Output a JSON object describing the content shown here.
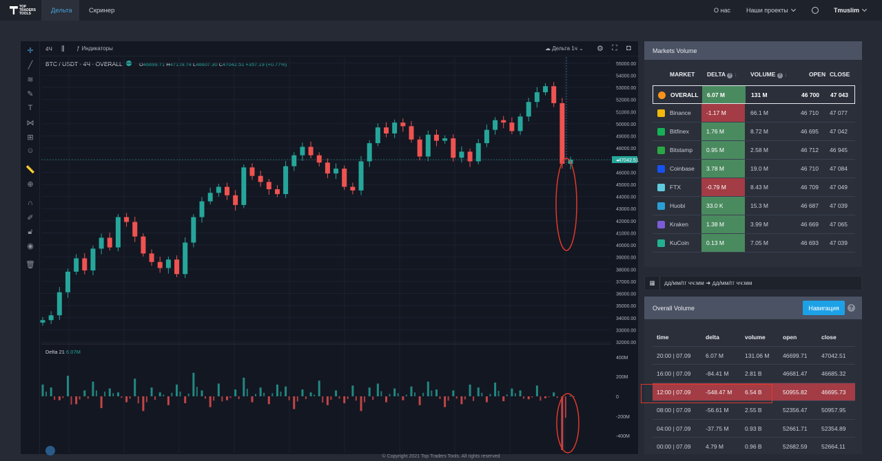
{
  "topnav": {
    "logo_text_1": "TOP",
    "logo_text_2": "TRADERS",
    "logo_text_3": "TOOLS",
    "tab_delta": "Дельта",
    "tab_screener": "Скринер",
    "about": "О нас",
    "projects": "Наши проекты",
    "user": "Tmuslim",
    "theme_icon": "sun-icon"
  },
  "chart_toolbar": {
    "timeframe": "4Ч",
    "indicators": "Индикаторы",
    "delta_dropdown": "Дельта 1ч"
  },
  "legend": {
    "symbol": "BTC / USDT · 4Ч · OVERALL",
    "o_label": "O",
    "o_value": "46699.71",
    "h_label": "H",
    "h_value": "47109.74",
    "l_label": "L",
    "l_value": "46607.30",
    "c_label": "C",
    "c_value": "47042.51",
    "change": "+357.19 (+0.77%)",
    "delta_label": "Delta",
    "delta_period": "21",
    "delta_value": "6.07M"
  },
  "price_axis": [
    "55000.00",
    "54000.00",
    "53000.00",
    "52000.00",
    "51000.00",
    "50000.00",
    "49000.00",
    "48000.00",
    "47042.51",
    "46000.00",
    "45000.00",
    "44000.00",
    "43000.00",
    "42000.00",
    "41000.00",
    "40000.00",
    "39000.00",
    "38000.00",
    "37000.00",
    "36000.00",
    "35000.00",
    "34000.00",
    "33000.00",
    "32000.00"
  ],
  "delta_axis": [
    "400M",
    "200M",
    "0",
    "-200M",
    "-400M"
  ],
  "chart_data": {
    "type": "candlestick",
    "title": "BTC / USDT · 4Ч · OVERALL",
    "ylim": [
      32000,
      55500
    ],
    "last_price": 47042.51,
    "series": [
      {
        "name": "BTC / USDT",
        "values": [
          33800,
          34200,
          36100,
          37800,
          38900,
          37900,
          39700,
          40600,
          39800,
          42300,
          41900,
          40700,
          39300,
          38600,
          38100,
          38800,
          37600,
          40200,
          42300,
          43600,
          44300,
          44800,
          44100,
          43300,
          46400,
          45700,
          45200,
          44600,
          44200,
          46500,
          47400,
          48100,
          47400,
          46800,
          45900,
          46300,
          44800,
          44500,
          46900,
          48400,
          49700,
          49200,
          50100,
          49800,
          48700,
          47300,
          49100,
          48600,
          48800,
          47200,
          47700,
          46900,
          48400,
          49500,
          50300,
          50100,
          49400,
          50600,
          51800,
          52600,
          53100,
          51700,
          46700,
          47042
        ]
      }
    ],
    "delta": {
      "name": "Delta",
      "values": [
        120,
        90,
        -40,
        210,
        -80,
        60,
        150,
        -120,
        80,
        40,
        -60,
        180,
        -150,
        90,
        40,
        -90,
        120,
        -70,
        240,
        60,
        -110,
        130,
        -40,
        70,
        190,
        -60,
        90,
        -80,
        120,
        100,
        -130,
        70,
        40,
        160,
        -90,
        60,
        -70,
        110,
        -150,
        90,
        130,
        -60,
        80,
        -40,
        100,
        -90,
        150,
        70,
        -110,
        60,
        -80,
        120,
        90,
        -60,
        140,
        -50,
        80,
        60,
        -30,
        110,
        -20,
        40,
        -548,
        6
      ]
    }
  },
  "markets_volume": {
    "title": "Markets Volume",
    "headers": {
      "market": "MARKET",
      "delta": "DELTA",
      "volume": "VOLUME",
      "open": "OPEN",
      "close": "CLOSE"
    },
    "rows": [
      {
        "market": "OVERALL",
        "delta": "6.07 M",
        "delta_sign": "pos",
        "volume": "131 M",
        "open": "46 700",
        "close": "47 043",
        "icon_color": "#f7931a",
        "icon": "bitcoin-icon"
      },
      {
        "market": "Binance",
        "delta": "-1.17 M",
        "delta_sign": "neg",
        "volume": "66.1 M",
        "open": "46 710",
        "close": "47 077",
        "icon_color": "#f0b90b",
        "icon": "binance-icon"
      },
      {
        "market": "Bitfinex",
        "delta": "1.76 M",
        "delta_sign": "pos",
        "volume": "8.72 M",
        "open": "46 695",
        "close": "47 042",
        "icon_color": "#16b157",
        "icon": "bitfinex-icon"
      },
      {
        "market": "Bitstamp",
        "delta": "0.95 M",
        "delta_sign": "pos",
        "volume": "2.58 M",
        "open": "46 712",
        "close": "46 945",
        "icon_color": "#2aa744",
        "icon": "bitstamp-icon"
      },
      {
        "market": "Coinbase",
        "delta": "3.78 M",
        "delta_sign": "pos",
        "volume": "19.0 M",
        "open": "46 710",
        "close": "47 084",
        "icon_color": "#1652f0",
        "icon": "coinbase-icon"
      },
      {
        "market": "FTX",
        "delta": "-0.79 M",
        "delta_sign": "neg",
        "volume": "8.43 M",
        "open": "46 709",
        "close": "47 049",
        "icon_color": "#5fcade",
        "icon": "ftx-icon"
      },
      {
        "market": "Huobi",
        "delta": "33.0 K",
        "delta_sign": "pos",
        "volume": "15.3 M",
        "open": "46 687",
        "close": "47 039",
        "icon_color": "#2a9fd6",
        "icon": "huobi-icon"
      },
      {
        "market": "Kraken",
        "delta": "1.38 M",
        "delta_sign": "pos",
        "volume": "3.99 M",
        "open": "46 669",
        "close": "47 065",
        "icon_color": "#7b5cd6",
        "icon": "kraken-icon"
      },
      {
        "market": "KuCoin",
        "delta": "0.13 M",
        "delta_sign": "pos",
        "volume": "7.05 M",
        "open": "46 693",
        "close": "47 039",
        "icon_color": "#23af91",
        "icon": "kucoin-icon"
      }
    ]
  },
  "date_range": {
    "placeholder": "дд/мм/гг чч:мм ➜ дд/мм/гг чч:мм"
  },
  "overall_volume": {
    "title": "Overall Volume",
    "nav_button": "Навигация",
    "help": "?",
    "headers": {
      "time": "time",
      "delta": "delta",
      "volume": "volume",
      "open": "open",
      "close": "close"
    },
    "rows": [
      {
        "time": "20:00 | 07.09",
        "delta": "6.07 M",
        "volume": "131.06 M",
        "open": "46699.71",
        "close": "47042.51",
        "hl": false
      },
      {
        "time": "16:00 | 07.09",
        "delta": "-84.41 M",
        "volume": "2.81 B",
        "open": "46681.47",
        "close": "46685.32",
        "hl": false
      },
      {
        "time": "12:00 | 07.09",
        "delta": "-548.47 M",
        "volume": "6.54 B",
        "open": "50955.82",
        "close": "46695.73",
        "hl": true
      },
      {
        "time": "08:00 | 07.09",
        "delta": "-56.61 M",
        "volume": "2.55 B",
        "open": "52356.47",
        "close": "50957.95",
        "hl": false
      },
      {
        "time": "04:00 | 07.09",
        "delta": "-37.75 M",
        "volume": "0.93 B",
        "open": "52661.71",
        "close": "52354.89",
        "hl": false
      },
      {
        "time": "00:00 | 07.09",
        "delta": "4.79 M",
        "volume": "0.96 B",
        "open": "52682.59",
        "close": "52664.11",
        "hl": false
      }
    ]
  },
  "footer": "© Copyright 2021 Top Traders Tools. All rights reserved",
  "colors": {
    "up": "#26a69a",
    "down": "#ef5350",
    "accent": "#1da1e6",
    "annotation": "#e0392b"
  }
}
